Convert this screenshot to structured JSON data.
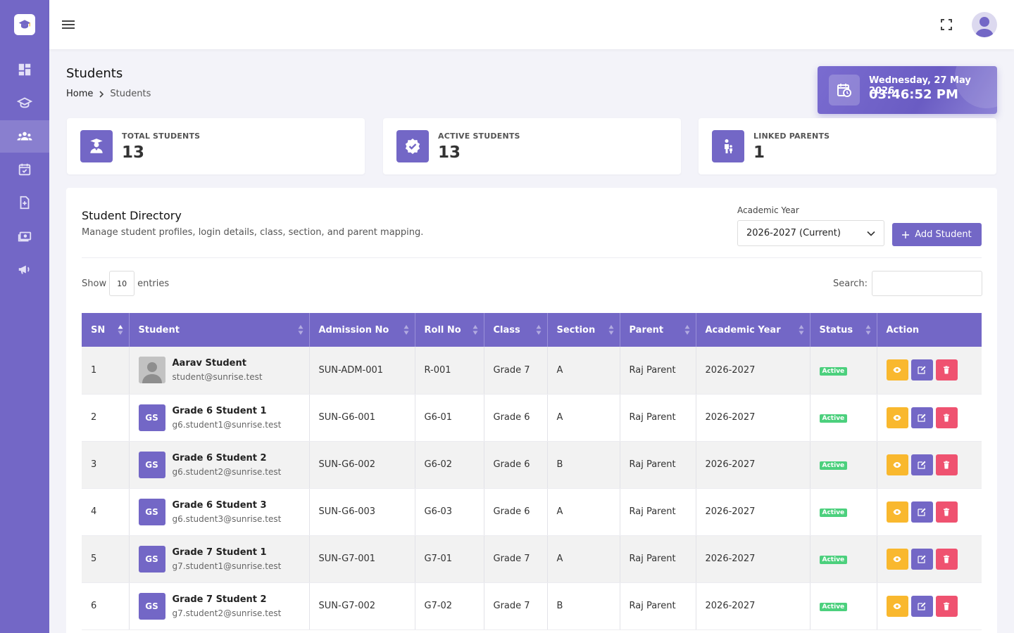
{
  "colors": {
    "primary": "#7367c6",
    "view": "#f9b82e",
    "delete": "#ef5270",
    "active": "#4cd07d"
  },
  "sidebar": {
    "items": [
      {
        "name": "dashboard-icon"
      },
      {
        "name": "academics-icon"
      },
      {
        "name": "students-icon",
        "active": true
      },
      {
        "name": "attendance-icon"
      },
      {
        "name": "documents-icon"
      },
      {
        "name": "fees-icon"
      },
      {
        "name": "announcements-icon"
      }
    ]
  },
  "header": {
    "title": "Students",
    "breadcrumb_home": "Home",
    "breadcrumb_current": "Students"
  },
  "clock": {
    "date": "Wednesday, 27 May 2026",
    "time": "03:46:52 PM"
  },
  "stats": [
    {
      "label": "TOTAL STUDENTS",
      "value": "13"
    },
    {
      "label": "ACTIVE STUDENTS",
      "value": "13"
    },
    {
      "label": "LINKED PARENTS",
      "value": "1"
    }
  ],
  "directory": {
    "title": "Student Directory",
    "subtitle": "Manage student profiles, login details, class, section, and parent mapping.",
    "academic_year_label": "Academic Year",
    "academic_year_value": "2026-2027 (Current)",
    "add_button": "Add Student",
    "show_label": "Show",
    "entries_value": "10",
    "entries_label": "entries",
    "search_label": "Search:"
  },
  "table": {
    "columns": [
      "SN",
      "Student",
      "Admission No",
      "Roll No",
      "Class",
      "Section",
      "Parent",
      "Academic Year",
      "Status",
      "Action"
    ],
    "rows": [
      {
        "sn": "1",
        "initials": "",
        "photo": true,
        "name": "Aarav Student",
        "email": "student@sunrise.test",
        "admission": "SUN-ADM-001",
        "roll": "R-001",
        "class": "Grade 7",
        "section": "A",
        "parent": "Raj Parent",
        "year": "2026-2027",
        "status": "Active"
      },
      {
        "sn": "2",
        "initials": "GS",
        "photo": false,
        "name": "Grade 6 Student 1",
        "email": "g6.student1@sunrise.test",
        "admission": "SUN-G6-001",
        "roll": "G6-01",
        "class": "Grade 6",
        "section": "A",
        "parent": "Raj Parent",
        "year": "2026-2027",
        "status": "Active"
      },
      {
        "sn": "3",
        "initials": "GS",
        "photo": false,
        "name": "Grade 6 Student 2",
        "email": "g6.student2@sunrise.test",
        "admission": "SUN-G6-002",
        "roll": "G6-02",
        "class": "Grade 6",
        "section": "B",
        "parent": "Raj Parent",
        "year": "2026-2027",
        "status": "Active"
      },
      {
        "sn": "4",
        "initials": "GS",
        "photo": false,
        "name": "Grade 6 Student 3",
        "email": "g6.student3@sunrise.test",
        "admission": "SUN-G6-003",
        "roll": "G6-03",
        "class": "Grade 6",
        "section": "A",
        "parent": "Raj Parent",
        "year": "2026-2027",
        "status": "Active"
      },
      {
        "sn": "5",
        "initials": "GS",
        "photo": false,
        "name": "Grade 7 Student 1",
        "email": "g7.student1@sunrise.test",
        "admission": "SUN-G7-001",
        "roll": "G7-01",
        "class": "Grade 7",
        "section": "A",
        "parent": "Raj Parent",
        "year": "2026-2027",
        "status": "Active"
      },
      {
        "sn": "6",
        "initials": "GS",
        "photo": false,
        "name": "Grade 7 Student 2",
        "email": "g7.student2@sunrise.test",
        "admission": "SUN-G7-002",
        "roll": "G7-02",
        "class": "Grade 7",
        "section": "B",
        "parent": "Raj Parent",
        "year": "2026-2027",
        "status": "Active"
      }
    ]
  }
}
